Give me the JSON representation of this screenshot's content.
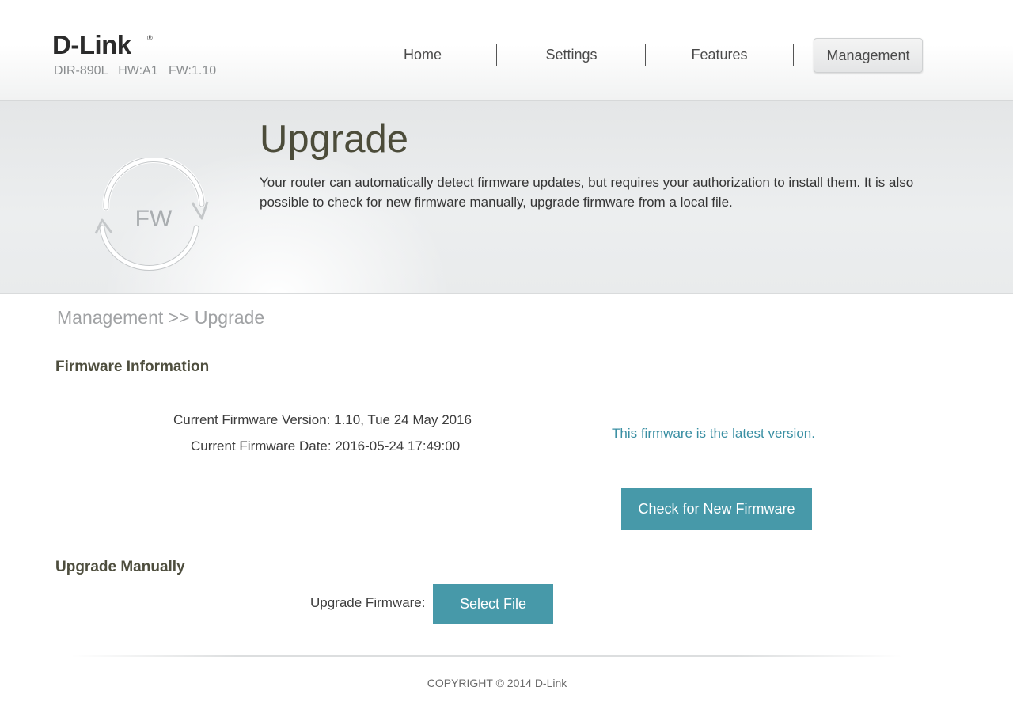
{
  "brand": {
    "logo_text": "D-Link",
    "logo_mark": "®",
    "model_info": "DIR-890L   HW:A1   FW:1.10"
  },
  "nav": {
    "items": [
      {
        "label": "Home"
      },
      {
        "label": "Settings"
      },
      {
        "label": "Features"
      },
      {
        "label": "Management"
      }
    ],
    "active": "Management"
  },
  "banner": {
    "icon_label": "FW",
    "title": "Upgrade",
    "description": "Your router can automatically detect firmware updates, but requires your authorization to install them. It is also possible to check for new firmware manually, upgrade firmware from a local file."
  },
  "breadcrumb": "Management >> Upgrade",
  "firmware_info": {
    "title": "Firmware Information",
    "version_line": "Current Firmware Version: 1.10, Tue 24 May 2016",
    "date_line": "Current Firmware Date: 2016-05-24 17:49:00",
    "status": "This firmware is the latest version.",
    "check_button": "Check for New Firmware"
  },
  "upgrade_manually": {
    "title": "Upgrade Manually",
    "label": "Upgrade Firmware:",
    "select_button": "Select File"
  },
  "footer": {
    "copyright": "COPYRIGHT © 2014 D-Link"
  },
  "colors": {
    "accent": "#4799a9",
    "status_text": "#3a8fa3",
    "title_text": "#4c4c3a"
  },
  "icons": {
    "banner_icon": "firmware-refresh-icon"
  }
}
